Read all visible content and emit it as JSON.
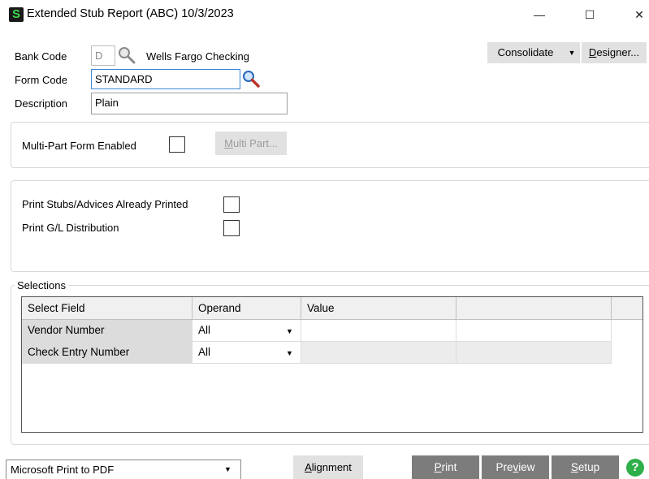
{
  "window": {
    "title": "Extended Stub Report (ABC) 10/3/2023",
    "app_icon_glyph": "S",
    "minimize_glyph": "—",
    "maximize_glyph": "☐",
    "close_glyph": "✕"
  },
  "header": {
    "bank_code_label": "Bank Code",
    "bank_code_value": "D",
    "bank_name": "Wells Fargo Checking",
    "form_code_label": "Form Code",
    "form_code_value": "STANDARD",
    "description_label": "Description",
    "description_value": "Plain",
    "consolidate_label": "Consolidate",
    "designer_label_underlined": "D",
    "designer_label_rest": "esigner..."
  },
  "multipart": {
    "enabled_label": "Multi-Part Form Enabled",
    "enabled_checked": false,
    "button_underlined": "M",
    "button_rest": "ulti Part..."
  },
  "options": {
    "print_stubs_label": "Print Stubs/Advices Already Printed",
    "print_stubs_checked": false,
    "print_gl_label": "Print G/L Distribution",
    "print_gl_checked": false
  },
  "selections": {
    "title": "Selections",
    "columns": [
      "Select Field",
      "Operand",
      "Value",
      ""
    ],
    "rows": [
      {
        "field": "Vendor Number",
        "operand": "All",
        "value": ""
      },
      {
        "field": "Check Entry Number",
        "operand": "All",
        "value": ""
      }
    ]
  },
  "footer": {
    "printer": "Microsoft Print to PDF",
    "alignment_underlined": "A",
    "alignment_rest": "lignment",
    "print_underlined": "P",
    "print_rest": "rint",
    "preview_pre": "Pre",
    "preview_underlined": "v",
    "preview_rest": "iew",
    "setup_underlined": "S",
    "setup_rest": "etup",
    "help_glyph": "?"
  },
  "colors": {
    "accent_focus": "#3c86d6",
    "dark_button": "#7c7c7c",
    "help_green": "#2eaf4a"
  }
}
